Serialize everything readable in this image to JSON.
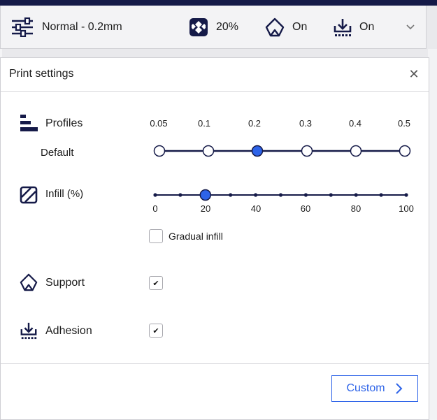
{
  "colors": {
    "accent": "#2d63e8",
    "navy": "#151a48"
  },
  "header": {
    "profile_icon": "sliders-icon",
    "profile_label": "Normal - 0.2mm",
    "infill_icon": "infill-pattern-icon",
    "infill_value": "20%",
    "support_icon": "support-icon",
    "support_value": "On",
    "adhesion_icon": "adhesion-icon",
    "adhesion_value": "On",
    "expand_icon": "chevron-down-icon"
  },
  "panel": {
    "title": "Print settings",
    "close_icon": "close-icon",
    "profiles": {
      "label": "Profiles",
      "sublabel": "Default",
      "ticks": [
        "0.05",
        "0.1",
        "0.2",
        "0.3",
        "0.4",
        "0.5"
      ],
      "selected": "0.2"
    },
    "infill": {
      "label": "Infill (%)",
      "ticks": [
        "0",
        "20",
        "40",
        "60",
        "80",
        "100"
      ],
      "value": 20,
      "gradual_label": "Gradual infill",
      "gradual_checked": false
    },
    "support": {
      "label": "Support",
      "checked": true
    },
    "adhesion": {
      "label": "Adhesion",
      "checked": true
    },
    "custom_button": "Custom"
  }
}
